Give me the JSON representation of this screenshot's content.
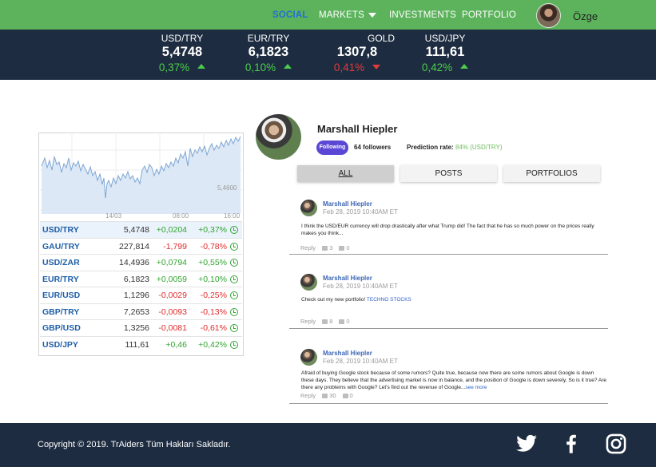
{
  "nav": {
    "items": [
      "SOCIAL",
      "MARKETS",
      "INVESTMENTS",
      "PORTFOLIO"
    ],
    "user_name": "Özge"
  },
  "ticker": [
    {
      "symbol": "USD/TRY",
      "value": "5,4748",
      "change": "0,37%",
      "direction": "up"
    },
    {
      "symbol": "EUR/TRY",
      "value": "6,1823",
      "change": "0,10%",
      "direction": "up"
    },
    {
      "symbol": "GOLD",
      "value": "1307,8",
      "change": "0,41%",
      "direction": "down"
    },
    {
      "symbol": "USD/JPY",
      "value": "111,61",
      "change": "0,42%",
      "direction": "up"
    }
  ],
  "mini_chart": {
    "price_label": "5,4600",
    "x_labels": [
      "14/03",
      "08:00",
      "16:00"
    ]
  },
  "markets": [
    {
      "symbol": "USD/TRY",
      "price": "5,4748",
      "delta": "+0,0204",
      "percent": "+0,37%"
    },
    {
      "symbol": "GAU/TRY",
      "price": "227,814",
      "delta": "-1,799",
      "percent": "-0,78%"
    },
    {
      "symbol": "USD/ZAR",
      "price": "14,4936",
      "delta": "+0,0794",
      "percent": "+0,55%"
    },
    {
      "symbol": "EUR/TRY",
      "price": "6,1823",
      "delta": "+0,0059",
      "percent": "+0,10%"
    },
    {
      "symbol": "EUR/USD",
      "price": "1,1296",
      "delta": "-0,0029",
      "percent": "-0,25%"
    },
    {
      "symbol": "GBP/TRY",
      "price": "7,2653",
      "delta": "-0,0093",
      "percent": "-0,13%"
    },
    {
      "symbol": "GBP/USD",
      "price": "1,3256",
      "delta": "-0,0081",
      "percent": "-0,61%"
    },
    {
      "symbol": "USD/JPY",
      "price": "111,61",
      "delta": "+0,46",
      "percent": "+0,42%"
    }
  ],
  "profile": {
    "name": "Marshall Hiepler",
    "follow_label": "Following",
    "followers": "64 followers",
    "prediction_label": "Prediction rate:",
    "prediction_value": "84% (USD/TRY)"
  },
  "tabs": [
    "ALL",
    "POSTS",
    "PORTFOLIOS"
  ],
  "posts": [
    {
      "author": "Marshall Hiepler",
      "date": "Feb 28, 2019 10:40AM ET",
      "text": "I think the USD/EUR currency will drop drastically after what Trump did! The fact that he has so much power on the prices really makes you  think...",
      "link": "",
      "reply": "Reply",
      "likes": "3",
      "dislikes": "0"
    },
    {
      "author": "Marshall Hiepler",
      "date": "Feb 28, 2019 10:40AM ET",
      "text": "Check out my new portfolio!",
      "link": "TECHNO STOCKS",
      "reply": "Reply",
      "likes": "8",
      "dislikes": "0"
    },
    {
      "author": "Marshall Hiepler",
      "date": "Feb 28, 2019 10:40AM ET",
      "text": "Afraid of buying Google stock because of some rumors? Quite true, because now there are some rumors about Google is down these days. They believe that the advertising market is now in balance, and the position of Google is down severely. So is it true? Are there any problems with Google? Let's find out the revenue of Google...",
      "link": "see more",
      "reply": "Reply",
      "likes": "30",
      "dislikes": "0"
    }
  ],
  "footer": {
    "copyright": "Copyright © 2019. TrAiders Tüm Hakları Sakladır.",
    "social_icons": [
      "twitter-icon",
      "facebook-icon",
      "instagram-icon"
    ]
  },
  "colors": {
    "nav_green": "#5cb35c",
    "dark_navy": "#1d2c40",
    "up": "#2fa52f",
    "down": "#e02b2b",
    "link": "#2170d8"
  }
}
